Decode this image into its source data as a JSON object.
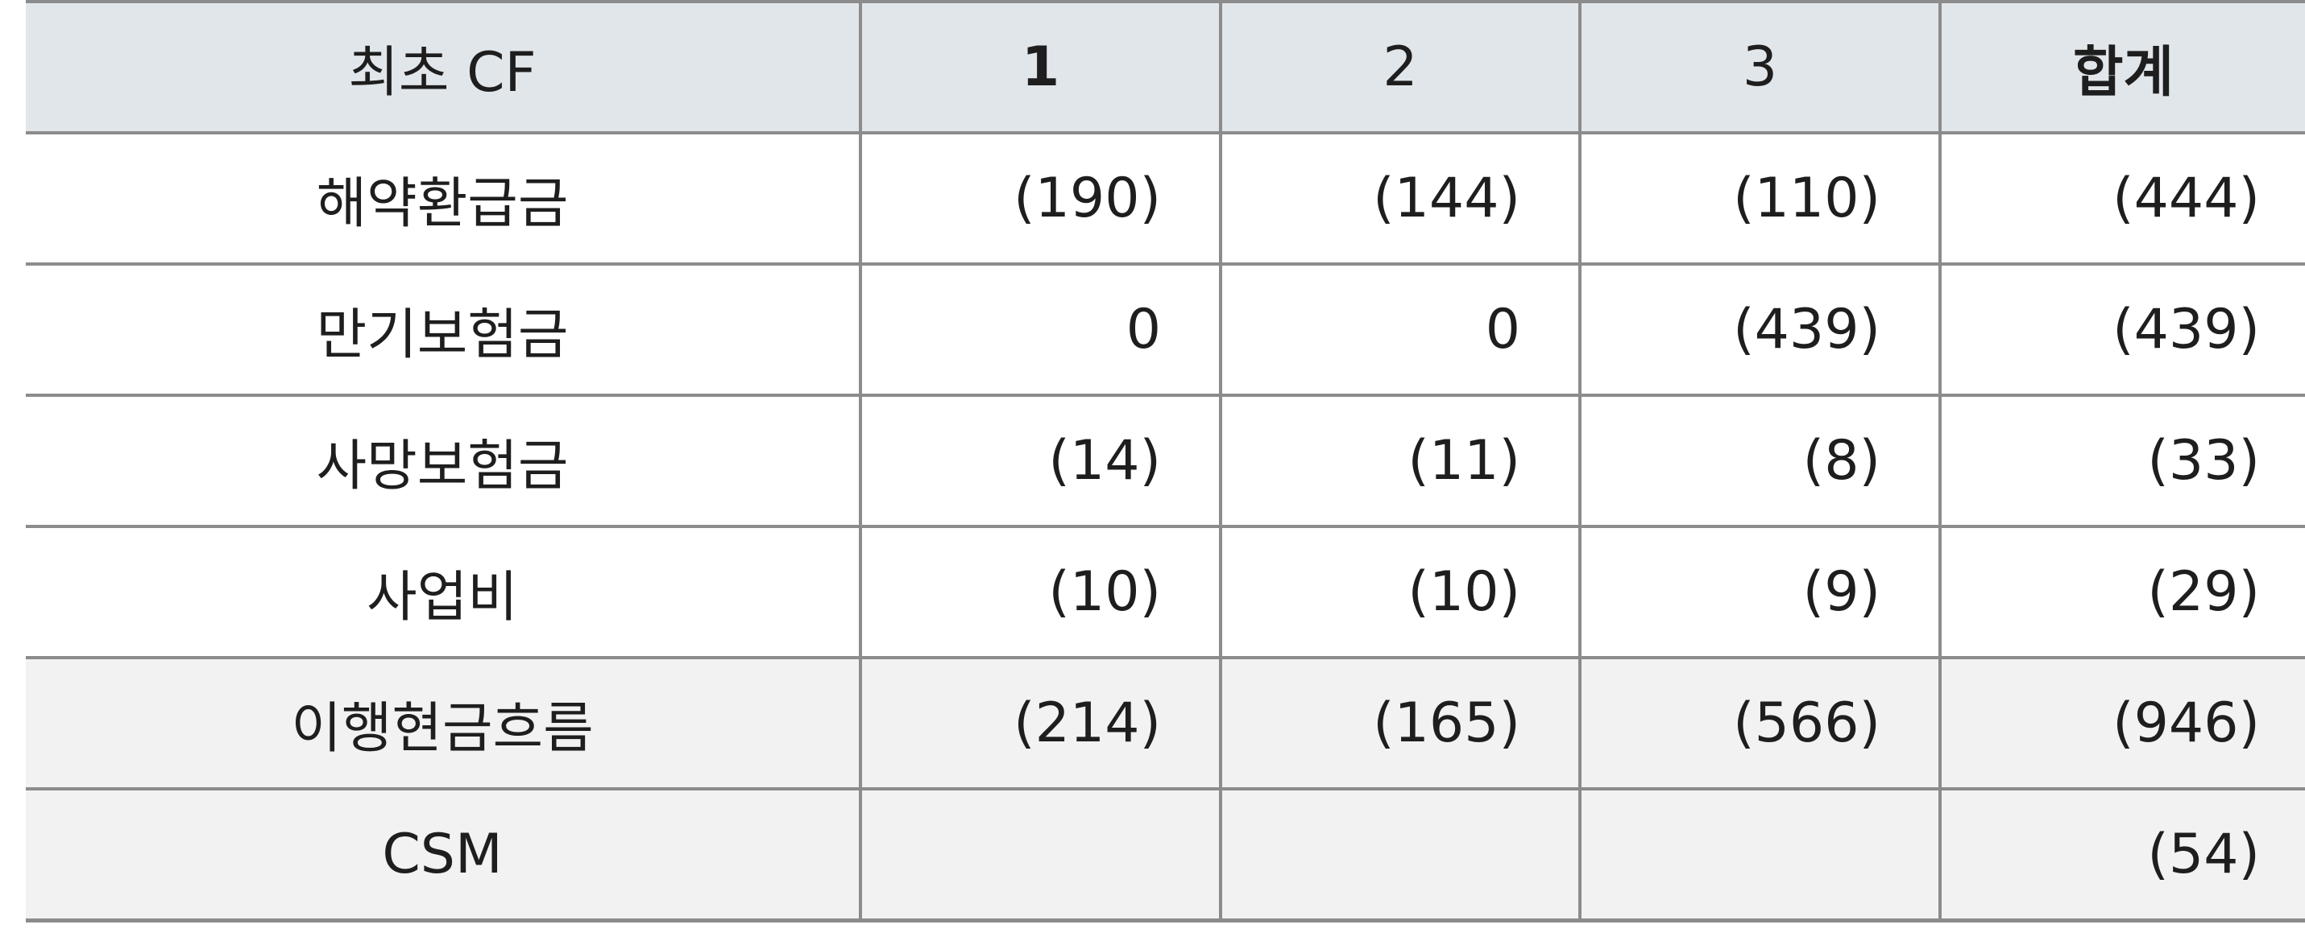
{
  "header": [
    "최초 CF",
    "1",
    "2",
    "3",
    "합계"
  ],
  "rows": [
    {
      "label": "해약환급금",
      "values": [
        "(190)",
        "(144)",
        "(110)",
        "(444)"
      ]
    },
    {
      "label": "만기보험금",
      "values": [
        "0",
        "0",
        "(439)",
        "(439)"
      ]
    },
    {
      "label": "사망보험금",
      "values": [
        "(14)",
        "(11)",
        "(8)",
        "(33)"
      ]
    },
    {
      "label": "사업비",
      "values": [
        "(10)",
        "(10)",
        "(9)",
        "(29)"
      ]
    },
    {
      "label": "이행현금흐름",
      "values": [
        "(214)",
        "(165)",
        "(566)",
        "(946)"
      ]
    },
    {
      "label": "CSM",
      "values": [
        "",
        "",
        "",
        "(54)"
      ]
    }
  ],
  "colors": {
    "header_bg": "#e1e6ea",
    "shaded_bg": "#f2f2f2",
    "border": "#8c8c8c"
  }
}
